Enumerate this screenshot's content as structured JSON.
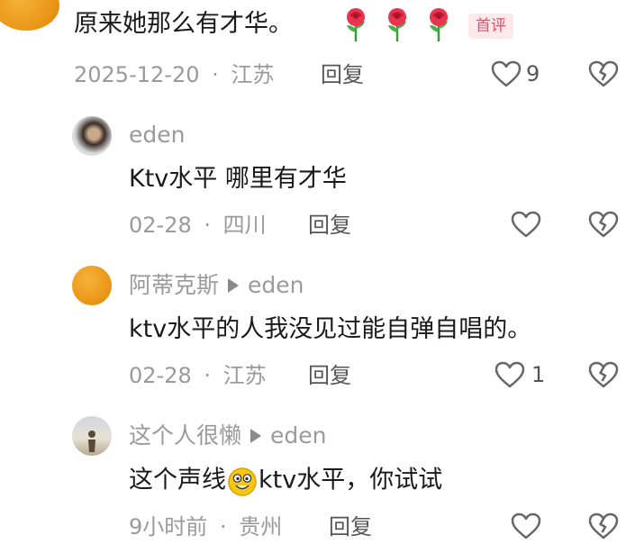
{
  "comments": [
    {
      "text": "原来她那么有才华。",
      "emoji_icons": [
        "rose-icon",
        "rose-icon",
        "rose-icon"
      ],
      "badge": "首评",
      "date": "2025-12-20",
      "location": "江苏",
      "reply_label": "回复",
      "like_count": "9"
    },
    {
      "author": "eden",
      "text": "Ktv水平 哪里有才华",
      "date": "02-28",
      "location": "四川",
      "reply_label": "回复"
    },
    {
      "author": "阿蒂克斯",
      "reply_to": "eden",
      "text": "ktv水平的人我没见过能自弹自唱的。",
      "date": "02-28",
      "location": "江苏",
      "reply_label": "回复",
      "like_count": "1"
    },
    {
      "author": "这个人很懒",
      "reply_to": "eden",
      "text_before": "这个声线",
      "text_emoji_icon": "smile-icon",
      "text_after": "ktv水平，你试试",
      "date": "9小时前",
      "location": "贵州",
      "reply_label": "回复"
    }
  ],
  "separator": "·",
  "colors": {
    "badge_bg": "#fde8ec",
    "badge_text": "#e0506a",
    "meta_text": "#9a9a9a"
  }
}
